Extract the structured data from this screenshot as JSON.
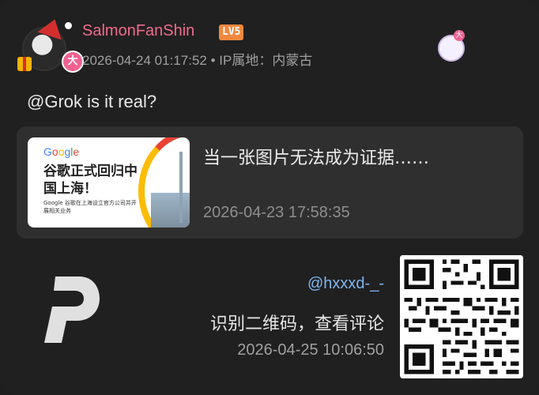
{
  "post": {
    "username": "SalmonFanShin",
    "level": "LV5",
    "badge": "大",
    "sticker_badge": "大",
    "datetime": "2026-04-24 01:17:52",
    "separator": "•",
    "ip_location": "IP属地：内蒙古",
    "comment": "@Grok is it real?"
  },
  "quote": {
    "thumb_brand": [
      "G",
      "o",
      "o",
      "g",
      "l",
      "e"
    ],
    "thumb_headline": "谷歌正式回归中国上海！",
    "thumb_sub": "Google 谷歌在上海设立官方公司并开展相关业务",
    "title": "当一张图片无法成为证据……",
    "time": "2026-04-23 17:58:35"
  },
  "footer": {
    "handle": "@hxxxd-_-",
    "scan_text": "识别二维码，查看评论",
    "time": "2026-04-25 10:06:50"
  },
  "colors": {
    "username": "#f06b8b",
    "level": "#f0883e",
    "handle": "#7fb6f0",
    "background": "#202020",
    "quote_bg": "#2f2f2f"
  },
  "icons": {
    "avatar": "christmas-avatar",
    "sticker": "anime-girl-sticker",
    "logo": "p-logo",
    "qr": "qr-code"
  }
}
